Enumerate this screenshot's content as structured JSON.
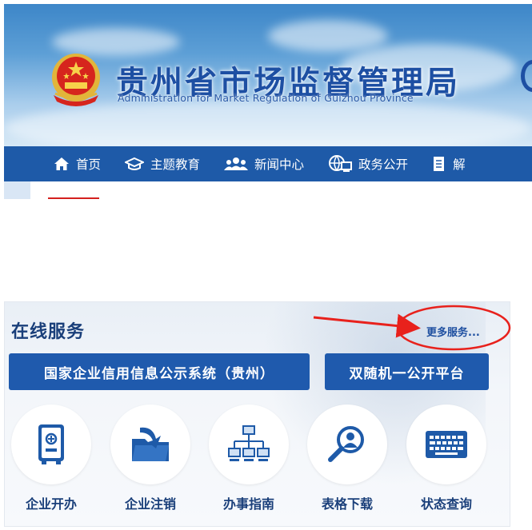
{
  "header": {
    "title": "贵州省市场监督管理局",
    "subtitle": "Administration for Market Regulation of Guizhou Province"
  },
  "nav": {
    "items": [
      {
        "label": "首页",
        "icon": "home-icon"
      },
      {
        "label": "主题教育",
        "icon": "graduation-cap-icon"
      },
      {
        "label": "新闻中心",
        "icon": "users-icon"
      },
      {
        "label": "政务公开",
        "icon": "globe-computer-icon"
      },
      {
        "label": "解",
        "icon": "document-icon"
      }
    ]
  },
  "online_services": {
    "title": "在线服务",
    "more_link": "更多服务...",
    "system_buttons": [
      {
        "label": "国家企业信用信息公示系统（贵州）"
      },
      {
        "label": "双随机一公开平台"
      }
    ],
    "services": [
      {
        "label": "企业开办",
        "icon": "safe-box-icon"
      },
      {
        "label": "企业注销",
        "icon": "folder-arrow-icon"
      },
      {
        "label": "办事指南",
        "icon": "network-computers-icon"
      },
      {
        "label": "表格下载",
        "icon": "magnifier-person-icon"
      },
      {
        "label": "状态查询",
        "icon": "keyboard-icon"
      }
    ]
  },
  "colors": {
    "nav_bg": "#1e5aa8",
    "button_bg": "#1f5aad",
    "title_blue": "#1d4fa3",
    "annotation_red": "#e8211c"
  }
}
